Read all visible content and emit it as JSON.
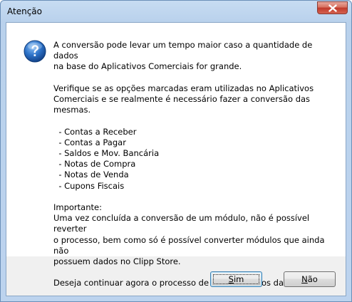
{
  "window": {
    "title": "Atenção"
  },
  "dialog": {
    "icon": "question-icon",
    "message": "A conversão pode levar um tempo maior caso a quantidade de dados\nna base do Aplicativos Comerciais for grande.\n\nVerifique se as opções marcadas eram utilizadas no Aplicativos\nComerciais e se realmente é necessário fazer a conversão das mesmas.\n\n  - Contas a Receber\n  - Contas a Pagar\n  - Saldos e Mov. Bancária\n  - Notas de Compra\n  - Notas de Venda\n  - Cupons Fiscais\n\nImportante:\nUma vez concluída a conversão de um módulo, não é possível reverter\no processo, bem como só é possível converter módulos que ainda não\npossuem dados no Clipp Store.\n\nDeseja continuar agora o processo de conversão dos dados?"
  },
  "buttons": {
    "yes": {
      "mnemonic": "S",
      "rest": "im"
    },
    "no": {
      "mnemonic": "N",
      "rest": "ão"
    }
  },
  "colors": {
    "frame": "#bcd3ee",
    "close": "#c0392b",
    "icon": "#1f5fb5"
  }
}
